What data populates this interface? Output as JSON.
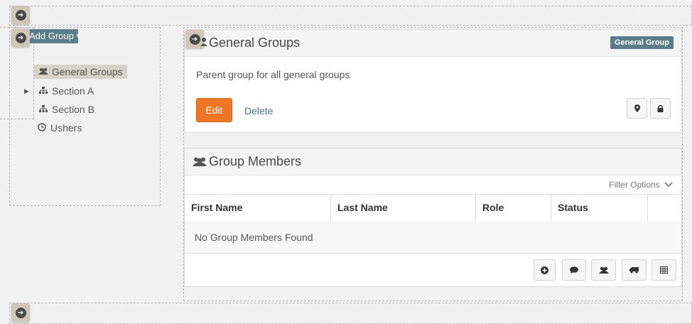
{
  "left": {
    "add_group_label": "Add Group",
    "tree": [
      {
        "label": "General Groups",
        "icon": "users-icon",
        "selected": true
      },
      {
        "label": "Section A",
        "icon": "sitemap-icon",
        "has_caret": true
      },
      {
        "label": "Section B",
        "icon": "sitemap-icon"
      },
      {
        "label": "Ushers",
        "icon": "clock-icon"
      }
    ]
  },
  "group_panel": {
    "title": "General Groups",
    "badge": "General Group",
    "description": "Parent group for all general groups",
    "edit_label": "Edit",
    "delete_label": "Delete"
  },
  "members_panel": {
    "title": "Group Members",
    "filter_label": "Filter Options",
    "columns": [
      "First Name",
      "Last Name",
      "Role",
      "Status"
    ],
    "empty_text": "No Group Members Found"
  },
  "colors": {
    "accent_orange": "#ee7624",
    "badge_teal": "#5a7d87",
    "link_blue": "#4a7a93"
  }
}
